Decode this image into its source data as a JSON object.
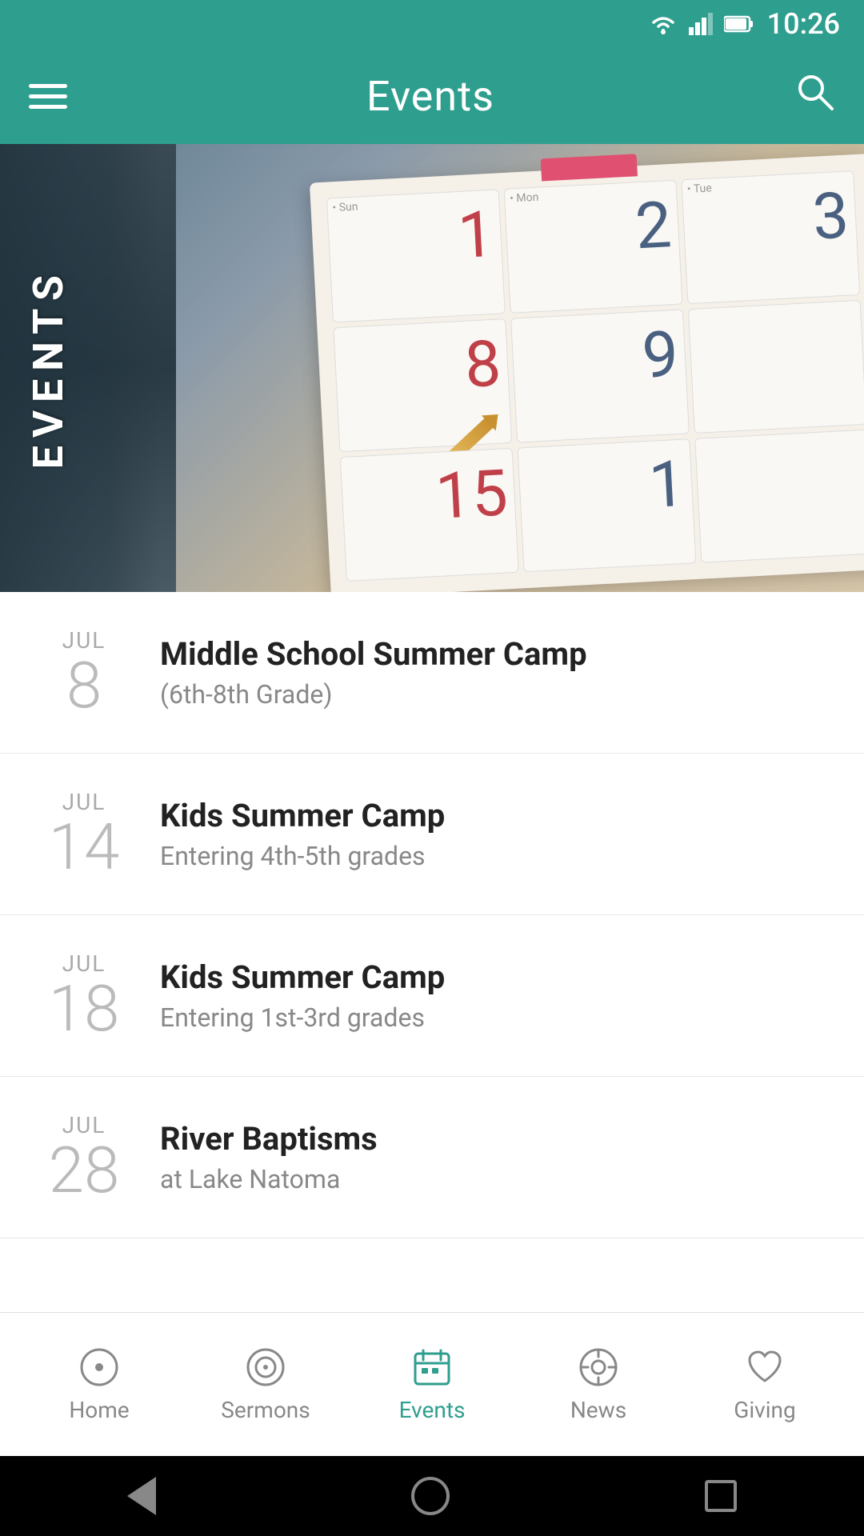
{
  "statusBar": {
    "time": "10:26"
  },
  "appBar": {
    "title": "Events",
    "menuLabel": "Menu",
    "searchLabel": "Search"
  },
  "hero": {
    "text": "EVENTS",
    "calendarNumbers": [
      {
        "num": "1",
        "color": "pink",
        "header": "• Sun"
      },
      {
        "num": "2",
        "color": "blue",
        "header": "• Mon"
      },
      {
        "num": "3",
        "color": "blue",
        "header": "• Tue"
      },
      {
        "num": "8",
        "color": "pink"
      },
      {
        "num": "9",
        "color": "blue"
      },
      {
        "num": ""
      },
      {
        "num": "15",
        "color": "pink"
      },
      {
        "num": "1",
        "color": "blue"
      },
      {
        "num": ""
      }
    ]
  },
  "events": [
    {
      "month": "JUL",
      "day": "8",
      "title": "Middle School Summer Camp",
      "subtitle": "(6th-8th Grade)"
    },
    {
      "month": "JUL",
      "day": "14",
      "title": "Kids Summer Camp",
      "subtitle": "Entering 4th-5th grades"
    },
    {
      "month": "JUL",
      "day": "18",
      "title": "Kids Summer Camp",
      "subtitle": "Entering 1st-3rd grades"
    },
    {
      "month": "JUL",
      "day": "28",
      "title": "River Baptisms",
      "subtitle": "at Lake Natoma"
    }
  ],
  "bottomNav": {
    "items": [
      {
        "id": "home",
        "label": "Home",
        "icon": "⊙",
        "active": false
      },
      {
        "id": "sermons",
        "label": "Sermons",
        "icon": "◎",
        "active": false
      },
      {
        "id": "events",
        "label": "Events",
        "icon": "▦",
        "active": true
      },
      {
        "id": "news",
        "label": "News",
        "icon": "◉",
        "active": false
      },
      {
        "id": "giving",
        "label": "Giving",
        "icon": "♡",
        "active": false
      }
    ]
  }
}
